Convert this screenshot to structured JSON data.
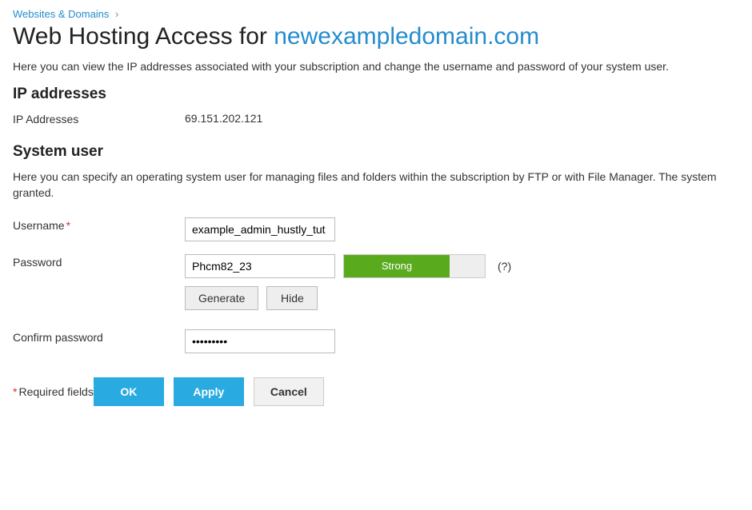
{
  "breadcrumb": {
    "parent": "Websites & Domains"
  },
  "page": {
    "title_static": "Web Hosting Access for ",
    "domain": "newexampledomain.com",
    "subtitle": "Here you can view the IP addresses associated with your subscription and change the username and password of your system user."
  },
  "ip_section": {
    "heading": "IP addresses",
    "label": "IP Addresses",
    "value": "69.151.202.121"
  },
  "user_section": {
    "heading": "System user",
    "desc": "Here you can specify an operating system user for managing files and folders within the subscription by FTP or with File Manager. The system granted.",
    "username_label": "Username",
    "username_value": "example_admin_hustly_tut",
    "password_label": "Password",
    "password_value": "Phcm82_23",
    "strength_text": "Strong",
    "help_text": "(?)",
    "generate_label": "Generate",
    "hide_label": "Hide",
    "confirm_label": "Confirm password",
    "confirm_value": "•••••••••"
  },
  "footer": {
    "required_hint": "Required fields",
    "ok": "OK",
    "apply": "Apply",
    "cancel": "Cancel"
  }
}
